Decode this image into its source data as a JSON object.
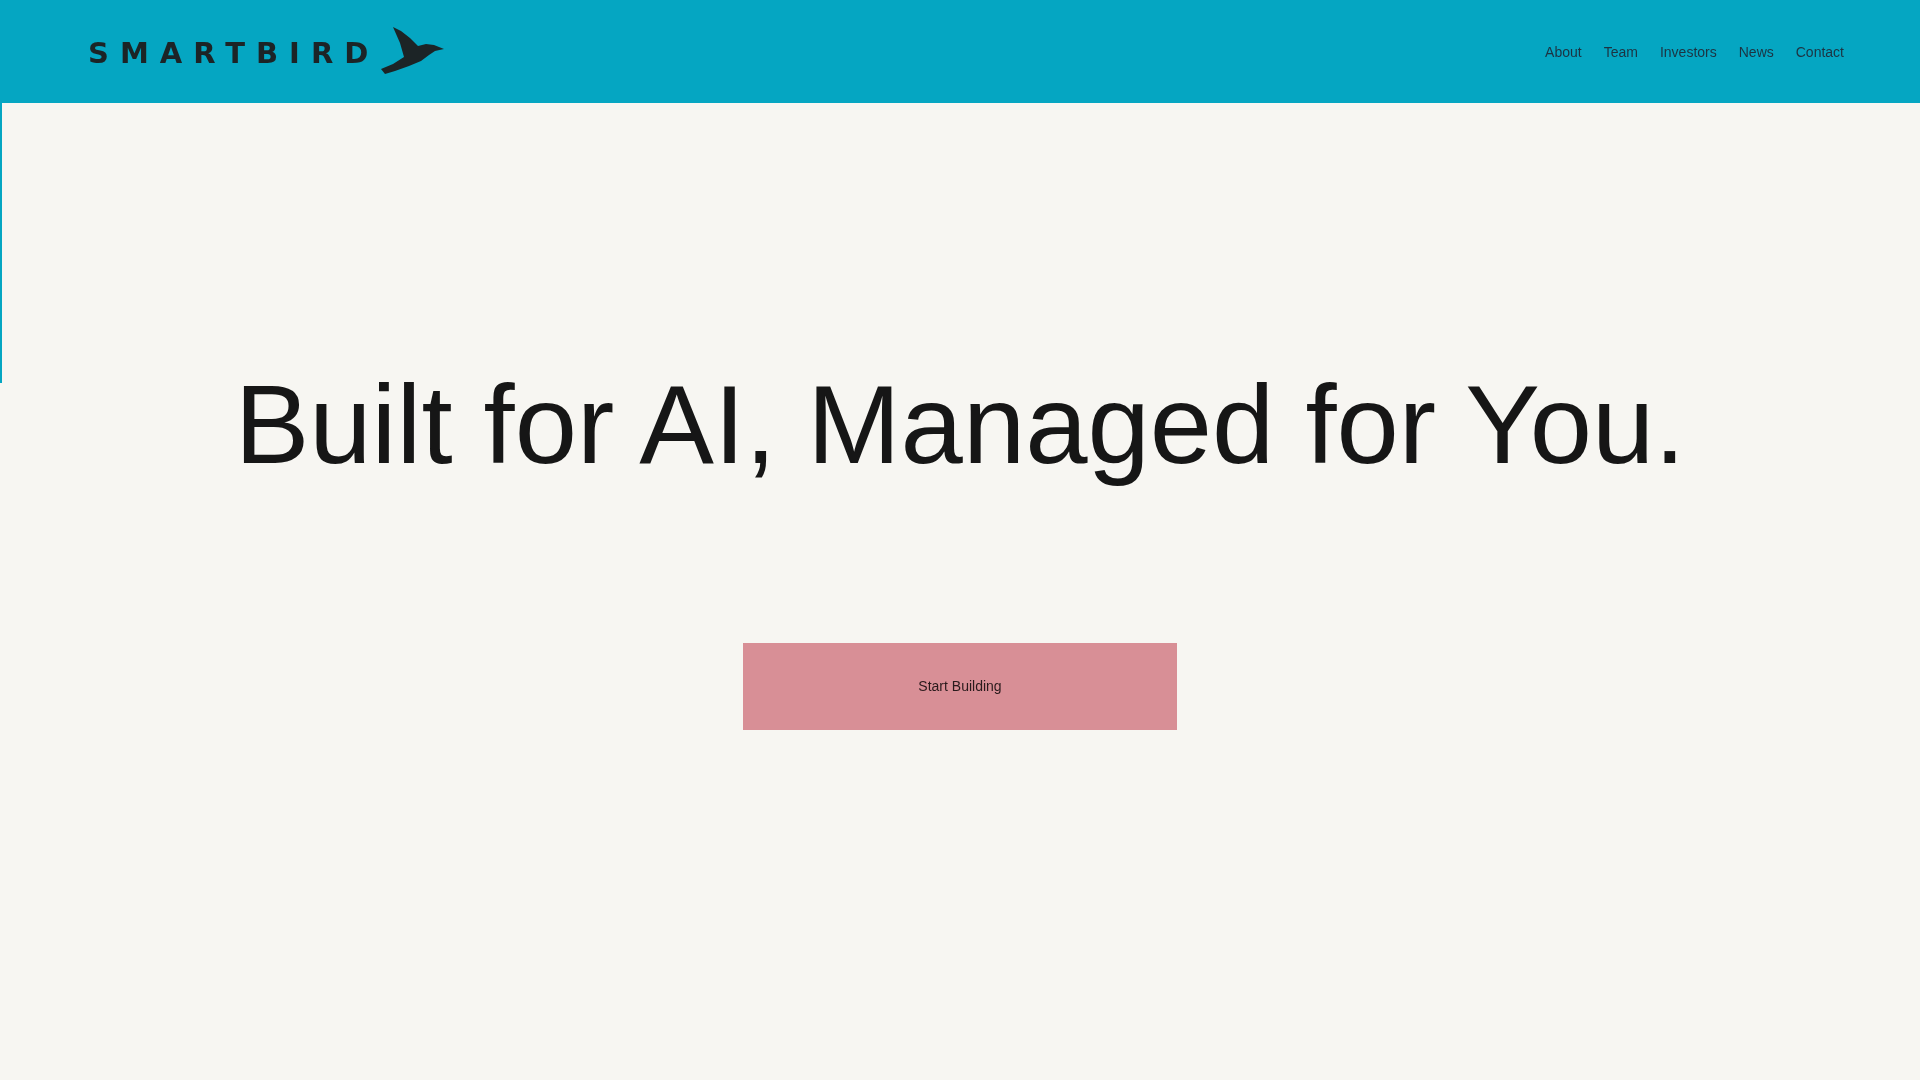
{
  "header": {
    "logo": {
      "text": "SMARTBIRD"
    },
    "nav": [
      {
        "label": "About"
      },
      {
        "label": "Team"
      },
      {
        "label": "Investors"
      },
      {
        "label": "News"
      },
      {
        "label": "Contact"
      }
    ]
  },
  "hero": {
    "headline": "Built for AI, Managed for You.",
    "button": {
      "label": "Start Building"
    }
  }
}
